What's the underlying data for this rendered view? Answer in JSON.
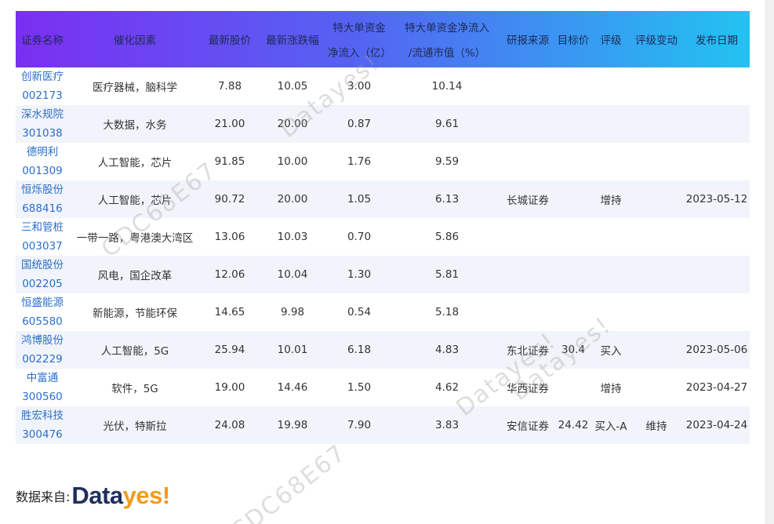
{
  "colors": {
    "header_gradient_start": "#7b2ff2",
    "header_gradient_end": "#22c3f1",
    "link": "#2a6fc9",
    "logo_dark": "#1f2f5c",
    "logo_orange": "#f29b1b"
  },
  "table": {
    "headers": {
      "security": "证券名称",
      "catalyst": "催化因素",
      "price": "最新股价",
      "change": "最新涨跌幅",
      "bigflow_l1": "特大单资金",
      "bigflow_l2": "净流入（亿）",
      "ratio_l1": "特大单资金净流入",
      "ratio_l2": "/流通市值（%）",
      "source": "研报来源",
      "target": "目标价",
      "rating": "评级",
      "rating_change": "评级变动",
      "date": "发布日期"
    },
    "rows": [
      {
        "name": "创新医疗",
        "code": "002173",
        "catalyst": "医疗器械，脑科学",
        "price": "7.88",
        "change": "10.05",
        "bigflow": "3.00",
        "ratio": "10.14",
        "source": "",
        "target": "",
        "rating": "",
        "rating_change": "",
        "date": ""
      },
      {
        "name": "深水规院",
        "code": "301038",
        "catalyst": "大数据，水务",
        "price": "21.00",
        "change": "20.00",
        "bigflow": "0.87",
        "ratio": "9.61",
        "source": "",
        "target": "",
        "rating": "",
        "rating_change": "",
        "date": ""
      },
      {
        "name": "德明利",
        "code": "001309",
        "catalyst": "人工智能，芯片",
        "price": "91.85",
        "change": "10.00",
        "bigflow": "1.76",
        "ratio": "9.59",
        "source": "",
        "target": "",
        "rating": "",
        "rating_change": "",
        "date": ""
      },
      {
        "name": "恒烁股份",
        "code": "688416",
        "catalyst": "人工智能，芯片",
        "price": "90.72",
        "change": "20.00",
        "bigflow": "1.05",
        "ratio": "6.13",
        "source": "长城证券",
        "target": "",
        "rating": "增持",
        "rating_change": "",
        "date": "2023-05-12"
      },
      {
        "name": "三和管桩",
        "code": "003037",
        "catalyst": "一带一路，粤港澳大湾区",
        "price": "13.06",
        "change": "10.03",
        "bigflow": "0.70",
        "ratio": "5.86",
        "source": "",
        "target": "",
        "rating": "",
        "rating_change": "",
        "date": ""
      },
      {
        "name": "国统股份",
        "code": "002205",
        "catalyst": "风电，国企改革",
        "price": "12.06",
        "change": "10.04",
        "bigflow": "1.30",
        "ratio": "5.81",
        "source": "",
        "target": "",
        "rating": "",
        "rating_change": "",
        "date": ""
      },
      {
        "name": "恒盛能源",
        "code": "605580",
        "catalyst": "新能源，节能环保",
        "price": "14.65",
        "change": "9.98",
        "bigflow": "0.54",
        "ratio": "5.18",
        "source": "",
        "target": "",
        "rating": "",
        "rating_change": "",
        "date": ""
      },
      {
        "name": "鸿博股份",
        "code": "002229",
        "catalyst": "人工智能，5G",
        "price": "25.94",
        "change": "10.01",
        "bigflow": "6.18",
        "ratio": "4.83",
        "source": "东北证券",
        "target": "30.4",
        "rating": "买入",
        "rating_change": "",
        "date": "2023-05-06"
      },
      {
        "name": "中富通",
        "code": "300560",
        "catalyst": "软件，5G",
        "price": "19.00",
        "change": "14.46",
        "bigflow": "1.50",
        "ratio": "4.62",
        "source": "华西证券",
        "target": "",
        "rating": "增持",
        "rating_change": "",
        "date": "2023-04-27"
      },
      {
        "name": "胜宏科技",
        "code": "300476",
        "catalyst": "光伏，特斯拉",
        "price": "24.08",
        "change": "19.98",
        "bigflow": "7.90",
        "ratio": "3.83",
        "source": "安信证券",
        "target": "24.42",
        "rating": "买入-A",
        "rating_change": "维持",
        "date": "2023-04-24"
      }
    ]
  },
  "watermarks": [
    "Datayes!",
    "CDC68E67",
    "Datayes!",
    "CDC68E67",
    "Datayes!",
    "CDC68E67"
  ],
  "footer": {
    "label": "数据来自:",
    "logo_part1": "Data",
    "logo_part2": "yes!"
  }
}
